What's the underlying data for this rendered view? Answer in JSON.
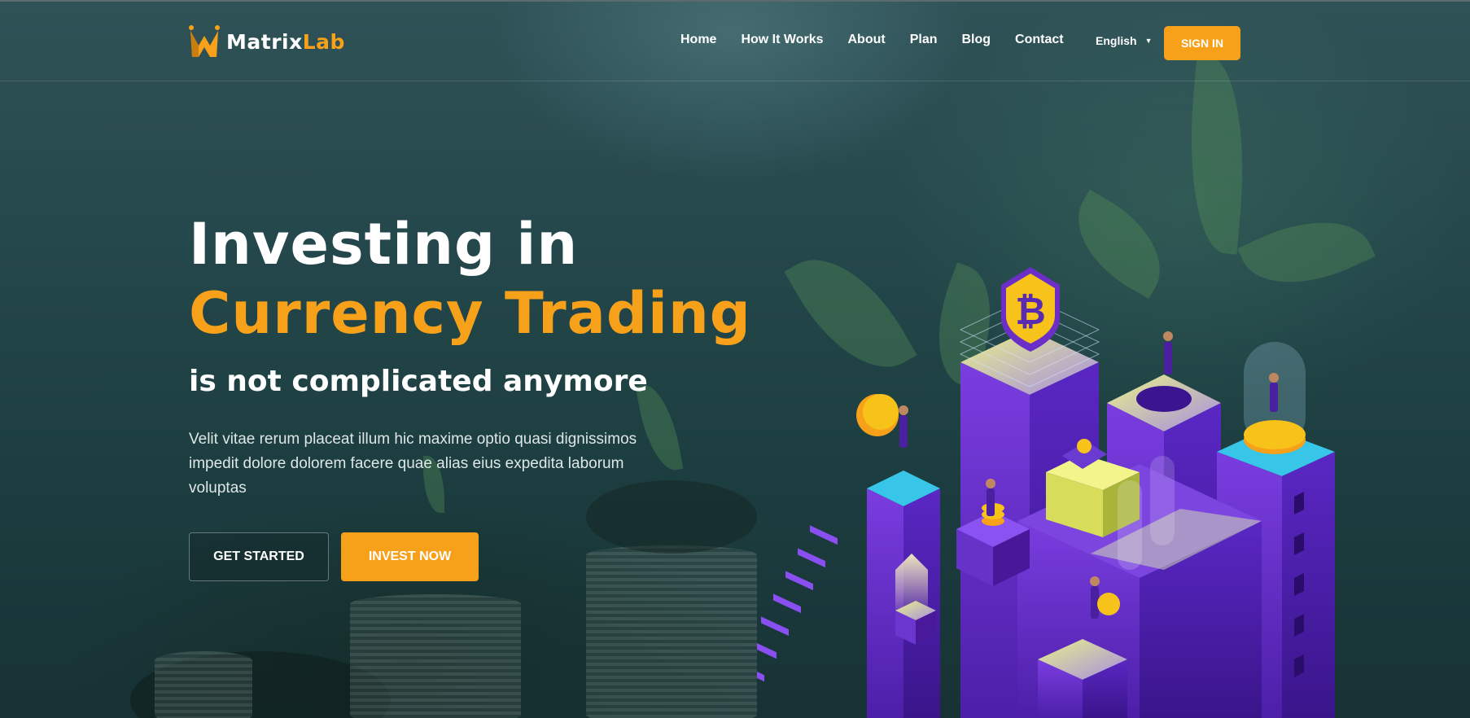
{
  "brand": {
    "name_part1": "Matrix",
    "name_part2": "Lab",
    "accent_color": "#f7a11a"
  },
  "nav": {
    "items": [
      {
        "label": "Home"
      },
      {
        "label": "How It Works"
      },
      {
        "label": "About"
      },
      {
        "label": "Plan"
      },
      {
        "label": "Blog"
      },
      {
        "label": "Contact"
      }
    ],
    "language": "English",
    "signin_label": "SIGN IN"
  },
  "hero": {
    "title_line1": "Investing in",
    "title_line2": "Currency Trading",
    "subtitle": "is not complicated anymore",
    "description": "Velit vitae rerum placeat illum hic maxime optio quasi dignissimos impedit dolore dolorem facere quae alias eius expedita laborum voluptas",
    "primary_button": "GET STARTED",
    "secondary_button": "INVEST NOW"
  },
  "illustration": {
    "icon": "bitcoin-icon"
  }
}
